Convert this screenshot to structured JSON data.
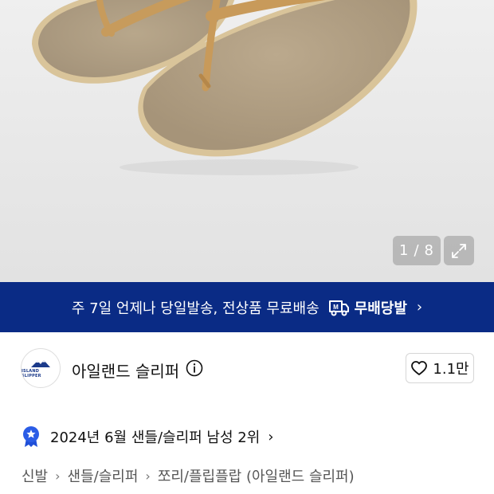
{
  "gallery": {
    "current_page": "1",
    "separator": "/",
    "total_pages": "8",
    "product_image": "beige suede flip-flop sandals"
  },
  "banner": {
    "text": "주 7일 언제나 당일발송, 전상품 무료배송",
    "badge_label": "무배당발",
    "colors": {
      "background": "#0a2b85",
      "text": "#ffffff"
    }
  },
  "brand": {
    "name": "아일랜드 슬리퍼",
    "logo_text": "ISLAND SLIPPER",
    "like_count": "1.1만"
  },
  "ranking": {
    "text": "2024년 6월 샌들/슬리퍼 남성 2위"
  },
  "breadcrumb": {
    "items": [
      "신발",
      "샌들/슬리퍼",
      "쪼리/플립플랍 (아일랜드 슬리퍼)"
    ]
  }
}
